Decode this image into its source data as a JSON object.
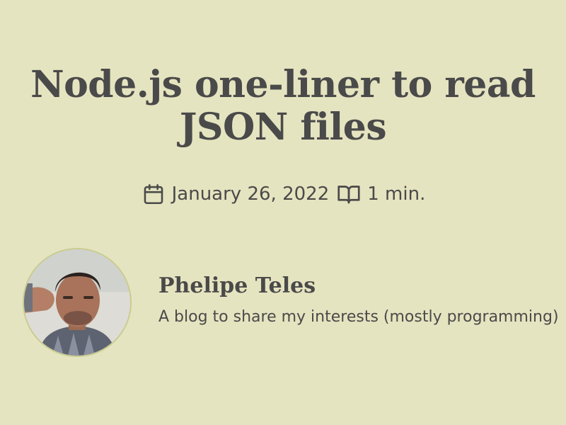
{
  "post": {
    "title": "Node.js one-liner to read JSON files",
    "date": "January 26, 2022",
    "reading_time": "1 min."
  },
  "author": {
    "name": "Phelipe Teles",
    "description": "A blog to share my interests (mostly programming)"
  },
  "icons": {
    "date": "calendar-icon",
    "reading_time": "open-book-icon"
  },
  "colors": {
    "background": "#e5e4c0",
    "text": "#4a4a4a",
    "avatar_border": "#c9cc8e"
  }
}
